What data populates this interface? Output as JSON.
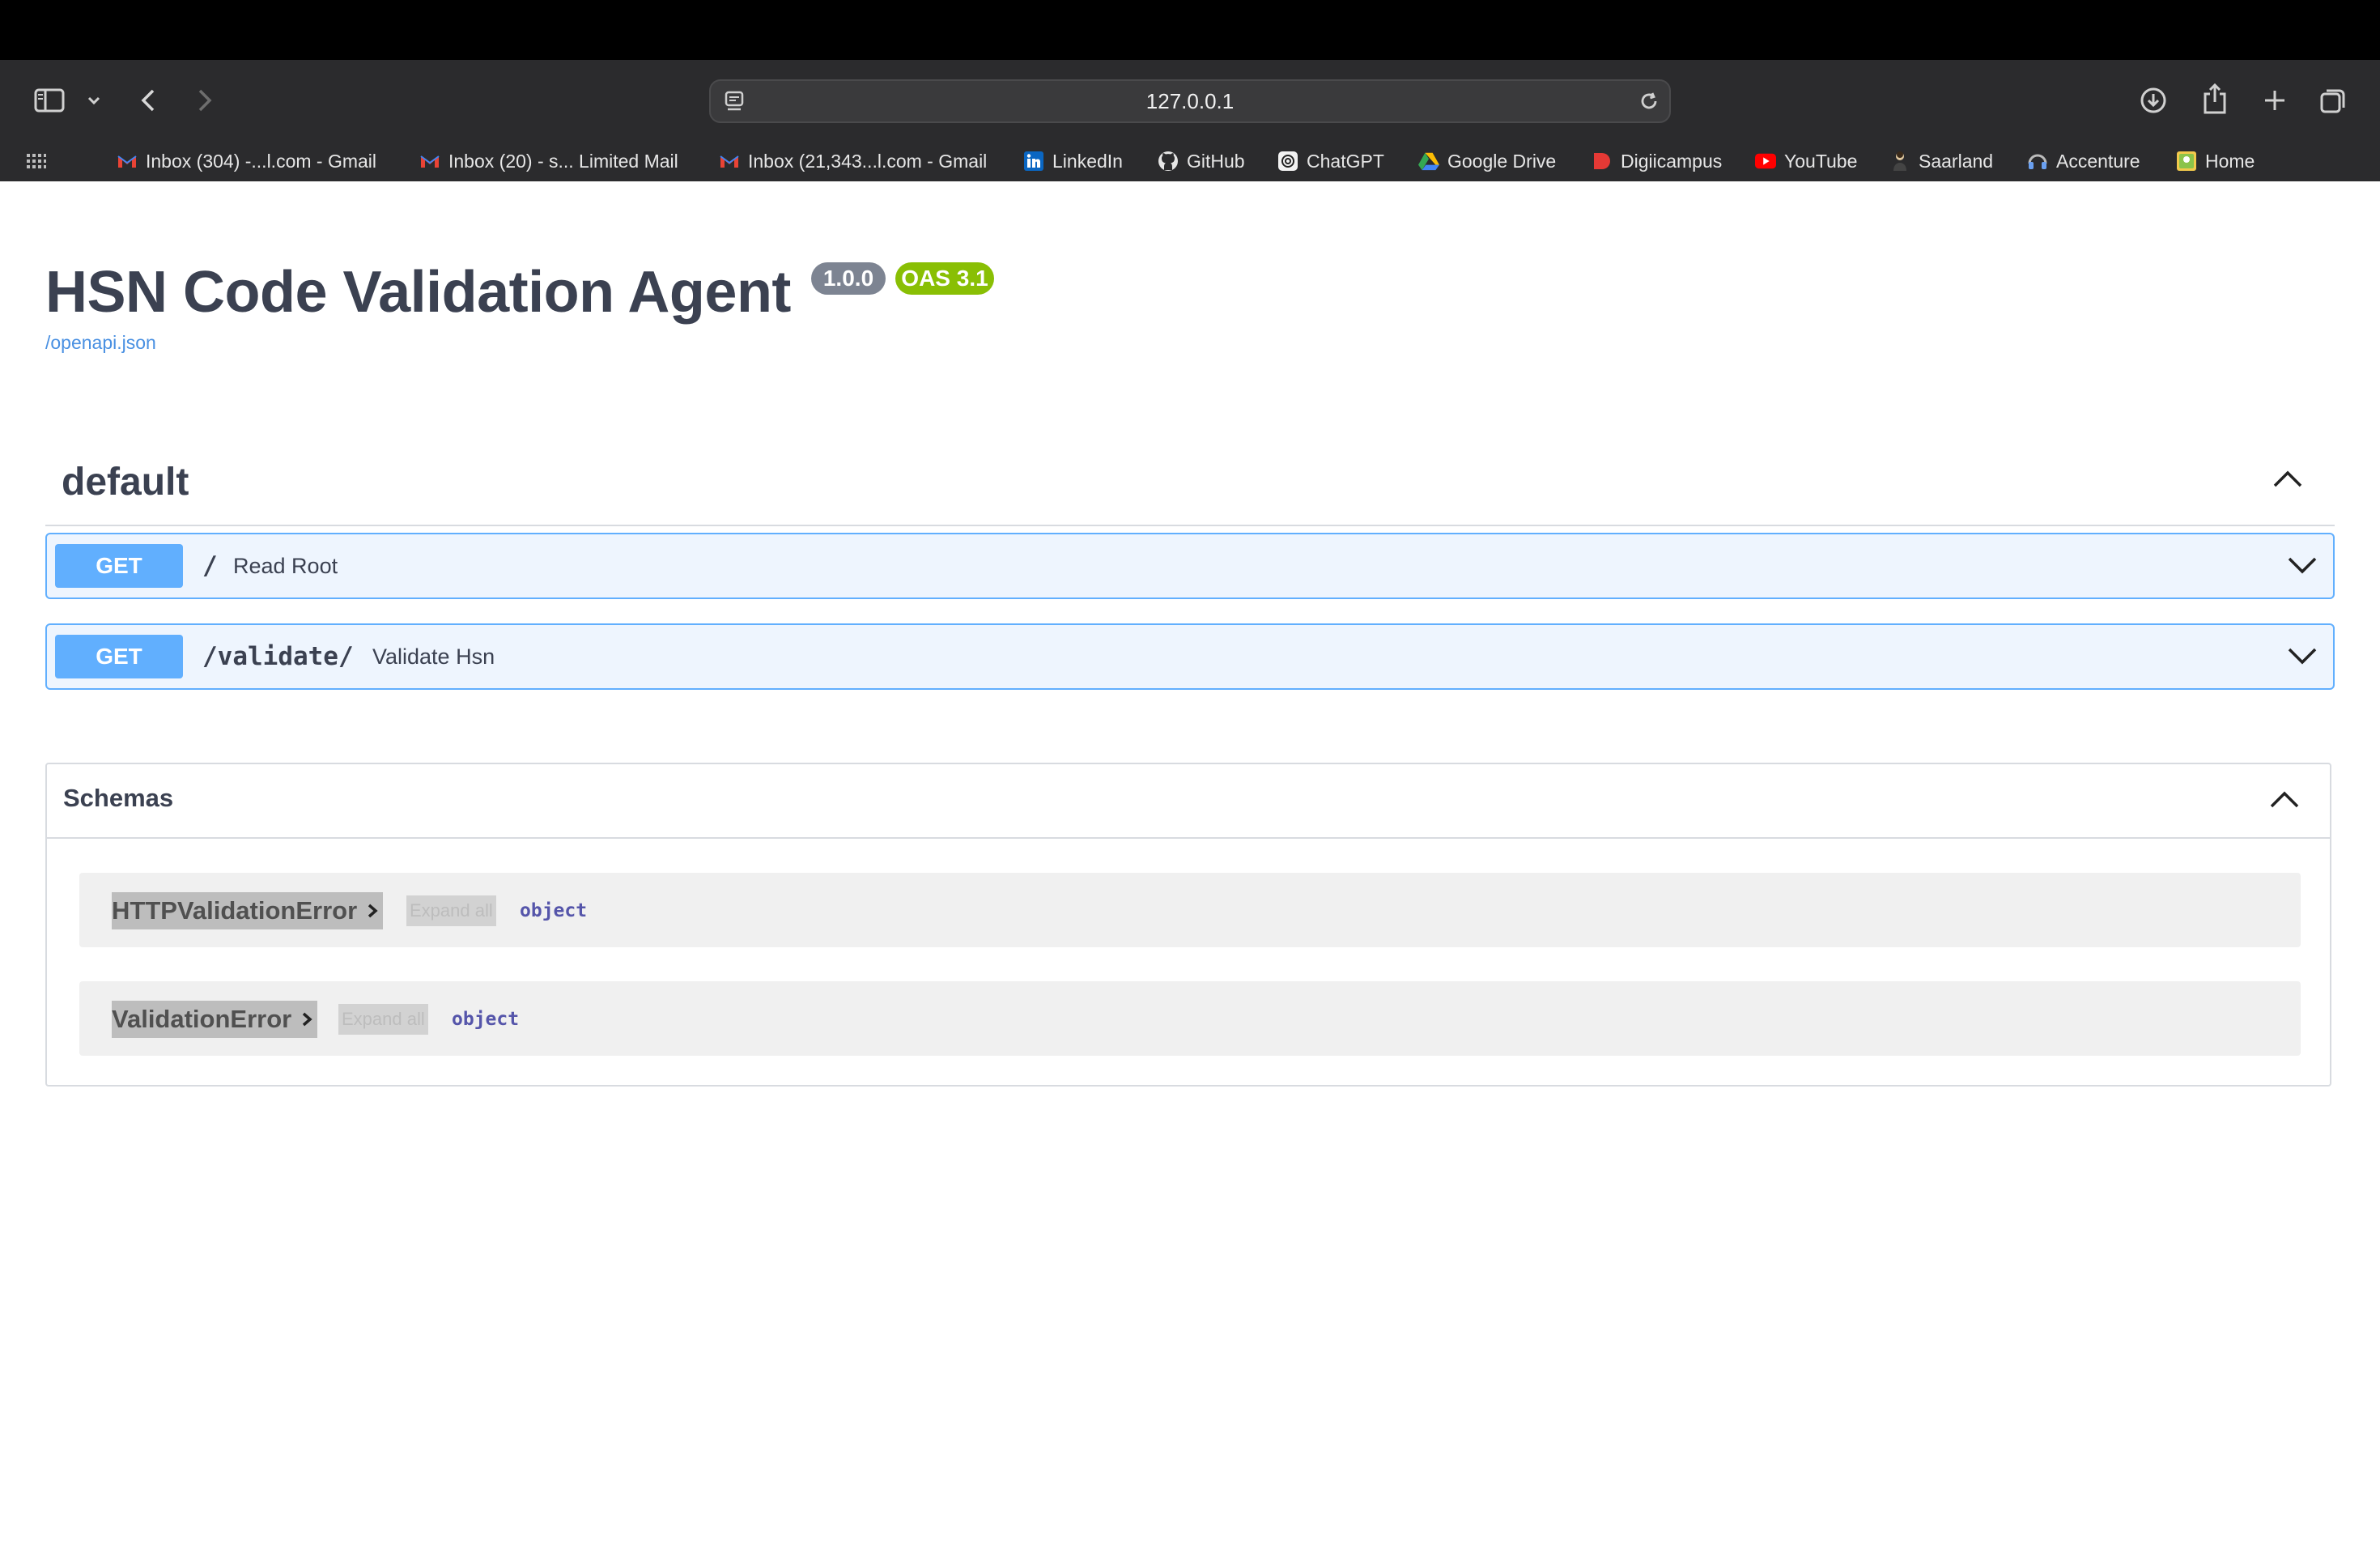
{
  "browser": {
    "url": "127.0.0.1",
    "bookmarks": [
      {
        "label": "Inbox (304) -...l.com - Gmail",
        "icon": "gmail-icon"
      },
      {
        "label": "Inbox (20) - s... Limited Mail",
        "icon": "gmail-icon"
      },
      {
        "label": "Inbox (21,343...l.com - Gmail",
        "icon": "gmail-icon"
      },
      {
        "label": "LinkedIn",
        "icon": "linkedin-icon"
      },
      {
        "label": "GitHub",
        "icon": "github-icon"
      },
      {
        "label": "ChatGPT",
        "icon": "chatgpt-icon"
      },
      {
        "label": "Google Drive",
        "icon": "google-drive-icon"
      },
      {
        "label": "Digiicampus",
        "icon": "digiicampus-icon"
      },
      {
        "label": "YouTube",
        "icon": "youtube-icon"
      },
      {
        "label": "Saarland",
        "icon": "saarland-icon"
      },
      {
        "label": "Accenture",
        "icon": "accenture-icon"
      },
      {
        "label": "Home",
        "icon": "home-icon"
      }
    ]
  },
  "api": {
    "title": "HSN Code Validation Agent",
    "version": "1.0.0",
    "oas": "OAS 3.1",
    "spec_link": "/openapi.json"
  },
  "tag": {
    "name": "default"
  },
  "operations": [
    {
      "method": "GET",
      "path": "/",
      "summary": "Read Root"
    },
    {
      "method": "GET",
      "path": "/validate/",
      "summary": "Validate Hsn"
    }
  ],
  "schemas": {
    "title": "Schemas",
    "models": [
      {
        "name": "HTTPValidationError",
        "expand_label": "Expand all",
        "type": "object"
      },
      {
        "name": "ValidationError",
        "expand_label": "Expand all",
        "type": "object"
      }
    ]
  },
  "colors": {
    "get_method": "#61affe",
    "get_background": "#eef5fe",
    "version_badge": "#7d8492",
    "oas_badge": "#89bf04",
    "link": "#4990e2"
  }
}
